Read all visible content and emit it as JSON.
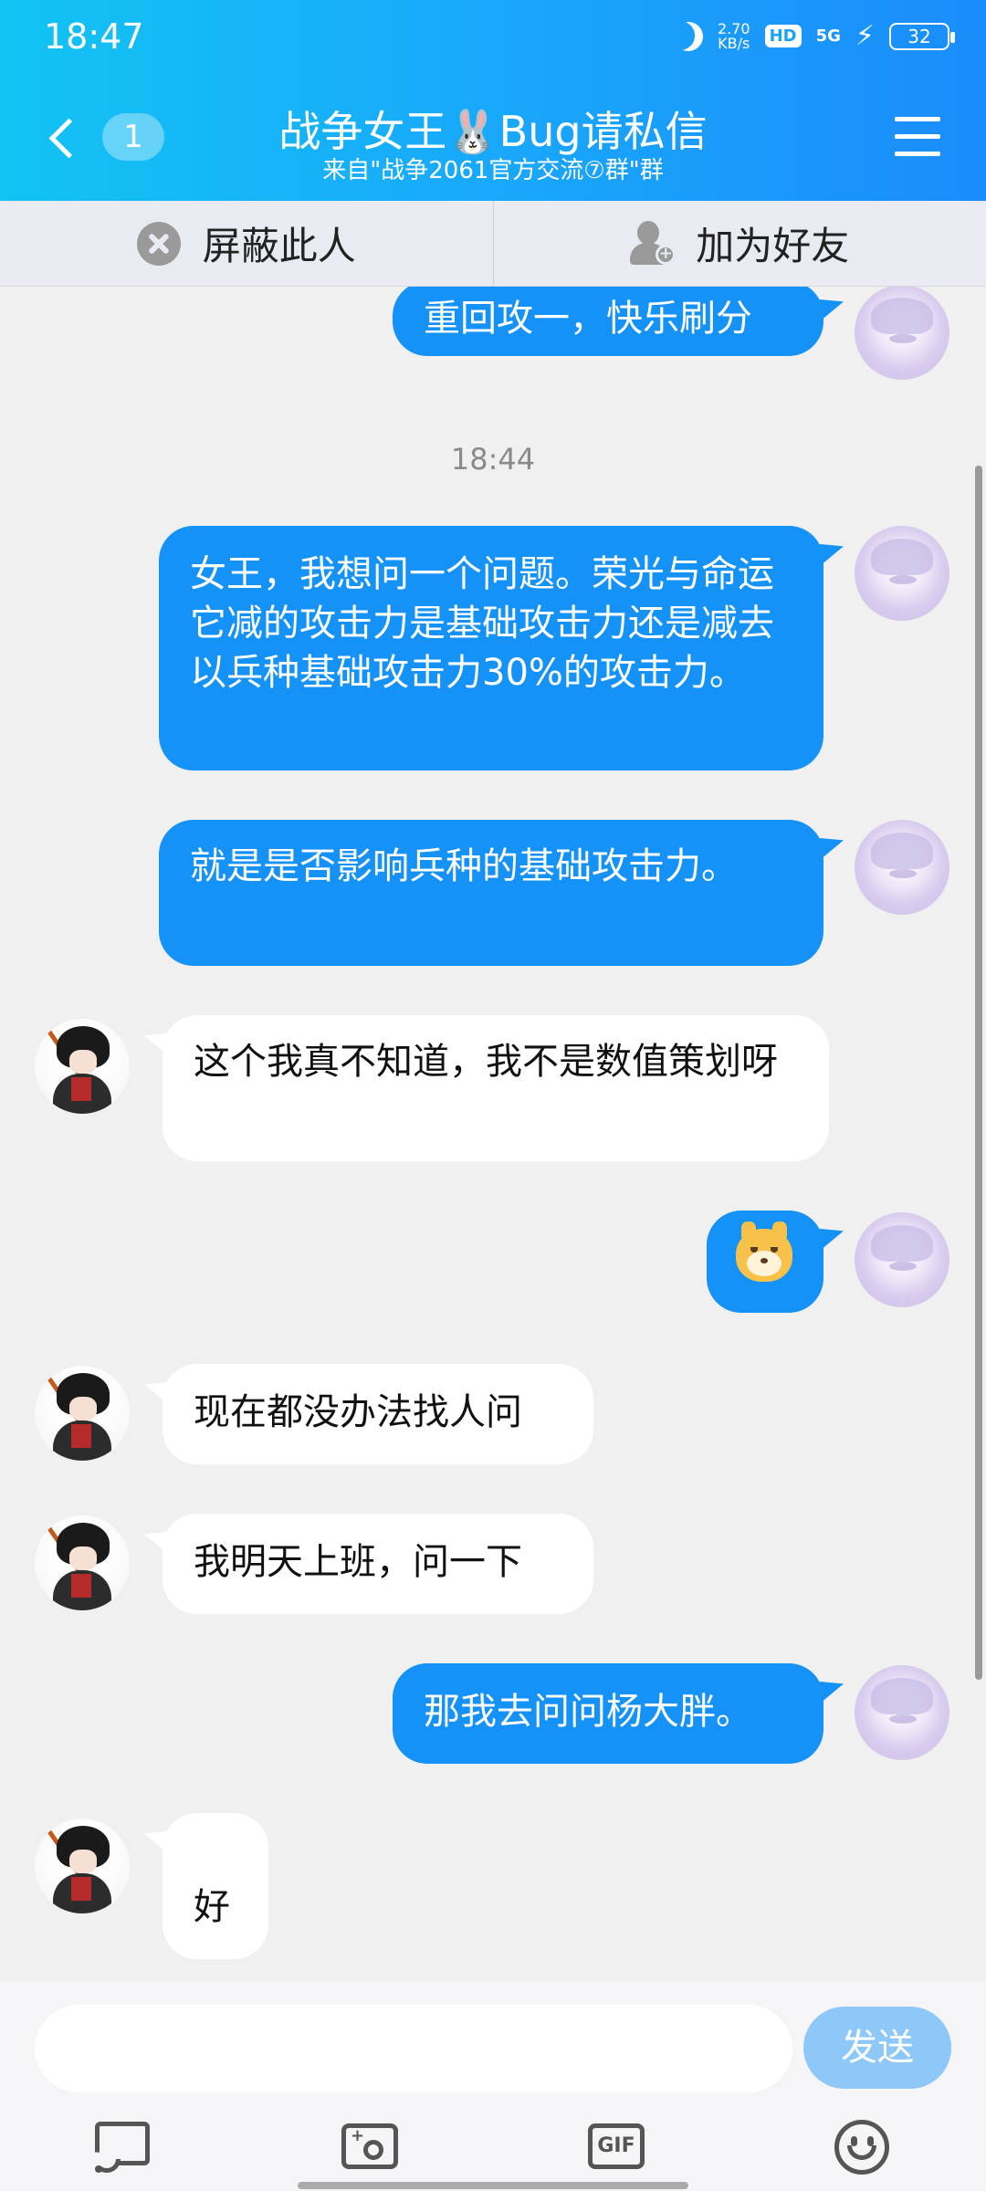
{
  "status_bar": {
    "time": "18:47",
    "net_speed_value": "2.70",
    "net_speed_unit": "KB/s",
    "hd": "HD",
    "signal": "5G",
    "battery": "32"
  },
  "header": {
    "unread_count": "1",
    "title": "战争女王🐰Bug请私信",
    "subtitle": "来自\"战争2061官方交流⑦群\"群"
  },
  "actions": {
    "block": "屏蔽此人",
    "add_friend": "加为好友"
  },
  "messages": [
    {
      "sender": "self",
      "text": "重回攻一，快乐刷分"
    },
    {
      "sender": "self",
      "text": "女王，我想问一个问题。荣光与命运它减的攻击力是基础攻击力还是减去以兵种基础攻击力30%的攻击力。"
    },
    {
      "sender": "self",
      "text": "就是是否影响兵种的基础攻击力。"
    },
    {
      "sender": "other",
      "text": "这个我真不知道，我不是数值策划呀"
    },
    {
      "sender": "self",
      "text": "",
      "sticker": "dog-emoji"
    },
    {
      "sender": "other",
      "text": "现在都没办法找人问"
    },
    {
      "sender": "other",
      "text": "我明天上班，问一下"
    },
    {
      "sender": "self",
      "text": "那我去问问杨大胖。"
    },
    {
      "sender": "other",
      "text": "好"
    }
  ],
  "timestamp": "18:44",
  "input": {
    "placeholder": "",
    "send_label": "发送"
  },
  "toolbar": {
    "gif_label": "GIF"
  },
  "colors": {
    "header_start": "#12c3f3",
    "header_end": "#1a8cfb",
    "self_bubble": "#1592f7",
    "other_bubble": "#ffffff",
    "send_button": "#8ec8f8"
  }
}
